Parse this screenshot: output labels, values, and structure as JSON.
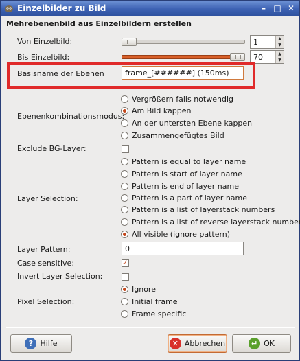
{
  "window": {
    "title": "Einzelbilder zu Bild",
    "app_icon": "gimp-icon",
    "controls": {
      "minimize": "–",
      "maximize": "□",
      "close": "✕"
    }
  },
  "heading": "Mehrebenenbild aus Einzelbildern erstellen",
  "von": {
    "label": "Von Einzelbild:",
    "value": "1",
    "level": 0.0
  },
  "bis": {
    "label": "Bis Einzelbild:",
    "value": "70",
    "level": 1.0
  },
  "basisname": {
    "label": "Basisname der Ebenen",
    "value": "frame_[######] (150ms)"
  },
  "combine": {
    "label": "Ebenenkombinationsmodus:",
    "options": [
      "Vergrößern falls notwendig",
      "Am Bild kappen",
      "An der untersten Ebene kappen",
      "Zusammengefügtes Bild"
    ],
    "selected": 1
  },
  "exclude_bg": {
    "label": "Exclude BG-Layer:",
    "checked": false
  },
  "layer_selection": {
    "label": "Layer Selection:",
    "options": [
      "Pattern is equal to layer name",
      "Pattern is start of layer name",
      "Pattern is end of layer name",
      "Pattern is a part of layer name",
      "Pattern is a list of layerstack numbers",
      "Pattern is a list of reverse layerstack numbers",
      "All visible (ignore pattern)"
    ],
    "selected": 6
  },
  "layer_pattern": {
    "label": "Layer Pattern:",
    "value": "0"
  },
  "case_sensitive": {
    "label": "Case sensitive:",
    "checked": true,
    "mark": "✓"
  },
  "invert": {
    "label": "Invert Layer Selection:",
    "checked": false
  },
  "pixel_selection": {
    "label": "Pixel Selection:",
    "options": [
      "Ignore",
      "Initial frame",
      "Frame specific"
    ],
    "selected": 0
  },
  "buttons": {
    "help": {
      "label": "Hilfe",
      "icon_glyph": "?"
    },
    "cancel": {
      "label": "Abbrechen",
      "icon_glyph": "✕"
    },
    "ok": {
      "label": "OK",
      "icon_glyph": "↵"
    }
  },
  "colors": {
    "accent": "#d8602a",
    "highlight": "#e02a2a",
    "titlebar": "#3d62b3"
  }
}
